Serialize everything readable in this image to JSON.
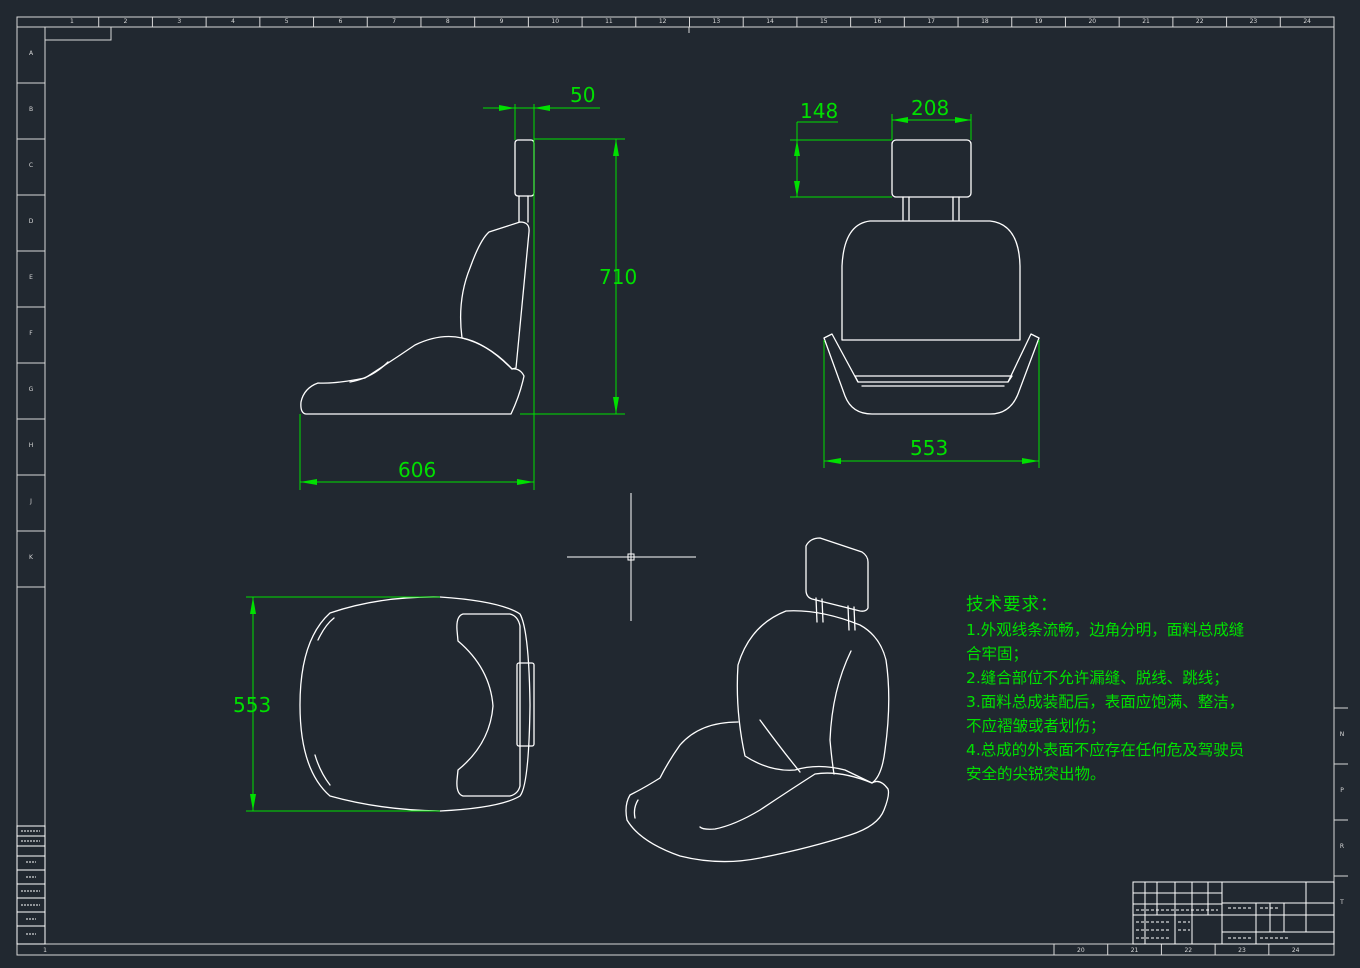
{
  "dimensions": {
    "side_headrest_thickness": "50",
    "side_overall_height": "710",
    "side_overall_depth": "606",
    "front_headrest_height": "148",
    "front_headrest_width": "208",
    "front_overall_width": "553",
    "top_overall_width": "553"
  },
  "technical_requirements": {
    "title": "技术要求：",
    "lines": [
      "1.外观线条流畅，边角分明，面料总成缝",
      "合牢固；",
      "2.缝合部位不允许漏缝、脱线、跳线；",
      "3.面料总成装配后，表面应饱满、整洁，",
      "不应褶皱或者划伤；",
      "4.总成的外表面不应存在任何危及驾驶员",
      "安全的尖锐突出物。"
    ]
  },
  "border_ruler": {
    "top": [
      "1",
      "2",
      "3",
      "4",
      "5",
      "6",
      "7",
      "8",
      "9",
      "10",
      "11",
      "12",
      "13",
      "14",
      "15",
      "16",
      "17",
      "18",
      "19",
      "20",
      "21",
      "22",
      "23",
      "24"
    ],
    "left": [
      "A",
      "B",
      "C",
      "D",
      "E",
      "F",
      "G",
      "H",
      "J",
      "K"
    ],
    "right": [
      "N",
      "P",
      "R",
      "T"
    ],
    "bottom": [
      "20",
      "21",
      "22",
      "23",
      "24"
    ]
  },
  "colors": {
    "background": "#212830",
    "geometry": "#ffffff",
    "dimension": "#00e000",
    "frame": "#d8d8d8"
  }
}
